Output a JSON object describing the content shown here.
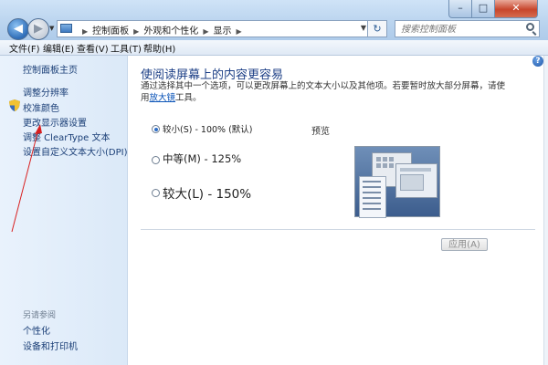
{
  "window": {
    "minimize_label": "–",
    "maximize_label": "□",
    "close_label": "✕"
  },
  "nav": {
    "back_icon": "arrow-left",
    "forward_icon": "arrow-right"
  },
  "address": {
    "crumbs": [
      "控制面板",
      "外观和个性化",
      "显示"
    ],
    "refresh_glyph": "↻"
  },
  "search": {
    "placeholder": "搜索控制面板"
  },
  "menu": [
    "文件(F)",
    "编辑(E)",
    "查看(V)",
    "工具(T)",
    "帮助(H)"
  ],
  "sidebar": {
    "home": "控制面板主页",
    "items": [
      "调整分辨率",
      "校准颜色",
      "更改显示器设置",
      "调整 ClearType 文本",
      "设置自定义文本大小(DPI)"
    ],
    "see_also_title": "另请参阅",
    "see_also": [
      "个性化",
      "设备和打印机"
    ]
  },
  "main": {
    "heading": "使阅读屏幕上的内容更容易",
    "desc_before": "通过选择其中一个选项，可以更改屏幕上的文本大小以及其他项。若要暂时放大部分屏幕，请使用",
    "desc_link": "放大镜",
    "desc_after": "工具。",
    "options": [
      {
        "label": "较小(S) - 100% (默认)",
        "checked": true
      },
      {
        "label": "中等(M) - 125%",
        "checked": false
      },
      {
        "label": "较大(L) - 150%",
        "checked": false
      }
    ],
    "preview_label": "预览",
    "apply_label": "应用(A)",
    "help_glyph": "?"
  },
  "colors": {
    "accent": "#1c3f86",
    "link": "#1b3f77",
    "annotation": "#d92020"
  }
}
